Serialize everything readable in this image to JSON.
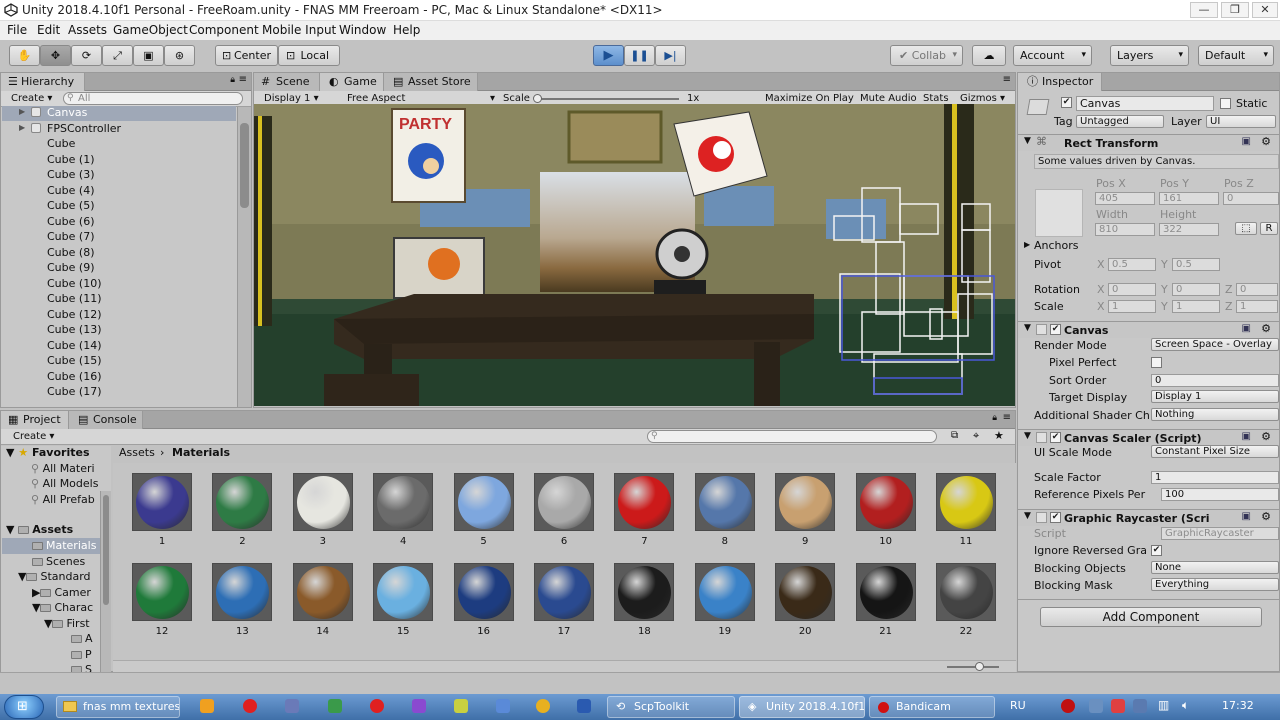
{
  "window": {
    "title": "Unity 2018.4.10f1 Personal - FreeRoam.unity - FNAS MM Freeroam - PC, Mac & Linux Standalone* <DX11>",
    "controls": [
      "—",
      "❐",
      "✕"
    ]
  },
  "menu": [
    "File",
    "Edit",
    "Assets",
    "GameObject",
    "Component",
    "Mobile Input",
    "Window",
    "Help"
  ],
  "toolbar": {
    "pivot": "Center",
    "space": "Local",
    "collab": "Collab",
    "account": "Account",
    "layers": "Layers",
    "layout": "Default"
  },
  "hierarchy": {
    "tab": "Hierarchy",
    "create": "Create",
    "search_placeholder": "All",
    "items": [
      "Canvas",
      "FPSController",
      "Cube",
      "Cube (1)",
      "Cube (3)",
      "Cube (4)",
      "Cube (5)",
      "Cube (6)",
      "Cube (7)",
      "Cube (8)",
      "Cube (9)",
      "Cube (10)",
      "Cube (11)",
      "Cube (12)",
      "Cube (13)",
      "Cube (14)",
      "Cube (15)",
      "Cube (16)",
      "Cube (17)"
    ]
  },
  "scene_tabs": [
    "Scene",
    "Game",
    "Asset Store"
  ],
  "game_bar": {
    "display": "Display 1",
    "aspect": "Free Aspect",
    "scale_label": "Scale",
    "scale_value": "1x",
    "maximize": "Maximize On Play",
    "mute": "Mute Audio",
    "stats": "Stats",
    "gizmos": "Gizmos"
  },
  "game_scene": {
    "poster_text": "PARTY"
  },
  "project": {
    "tabs": [
      "Project",
      "Console"
    ],
    "create": "Create",
    "favorites_label": "Favorites",
    "favorites": [
      "All Materi",
      "All Models",
      "All Prefab"
    ],
    "assets_label": "Assets",
    "tree": [
      "Materials",
      "Scenes",
      "Standard",
      "Camer",
      "Charac",
      "First",
      "A",
      "P",
      "S"
    ],
    "breadcrumb": [
      "Assets",
      "Materials"
    ],
    "materials": [
      {
        "label": "1",
        "color": "#3b3a8f"
      },
      {
        "label": "2",
        "color": "#2e7b45"
      },
      {
        "label": "3",
        "color": "#e6e6e0"
      },
      {
        "label": "4",
        "color": "#6b6b6b"
      },
      {
        "label": "5",
        "color": "#7ea7de"
      },
      {
        "label": "6",
        "color": "#a9a9a9"
      },
      {
        "label": "7",
        "color": "#cc1a1a"
      },
      {
        "label": "8",
        "color": "#5577aa"
      },
      {
        "label": "9",
        "color": "#c8a070"
      },
      {
        "label": "10",
        "color": "#b21f1f"
      },
      {
        "label": "11",
        "color": "#d8c814"
      },
      {
        "label": "12",
        "color": "#1f7a3a"
      },
      {
        "label": "13",
        "color": "#2d6eb5"
      },
      {
        "label": "14",
        "color": "#8a5a2a"
      },
      {
        "label": "15",
        "color": "#6ab0e0"
      },
      {
        "label": "16",
        "color": "#1d3c80"
      },
      {
        "label": "17",
        "color": "#2a4a90"
      },
      {
        "label": "18",
        "color": "#1c1c1c"
      },
      {
        "label": "19",
        "color": "#3a82c8"
      },
      {
        "label": "20",
        "color": "#3a2a18"
      },
      {
        "label": "21",
        "color": "#151515"
      },
      {
        "label": "22",
        "color": "#444444"
      }
    ]
  },
  "inspector": {
    "tab": "Inspector",
    "object_name": "Canvas",
    "static": "Static",
    "tag_label": "Tag",
    "tag_value": "Untagged",
    "layer_label": "Layer",
    "layer_value": "UI",
    "rect_transform": {
      "title": "Rect Transform",
      "note": "Some values driven by Canvas.",
      "pos_x_label": "Pos X",
      "pos_y_label": "Pos Y",
      "pos_z_label": "Pos Z",
      "pos_x": "405",
      "pos_y": "161",
      "pos_z": "0",
      "width_label": "Width",
      "height_label": "Height",
      "width": "810",
      "height": "322",
      "r_button": "R",
      "anchors": "Anchors",
      "pivot_label": "Pivot",
      "pivot_x": "0.5",
      "pivot_y": "0.5",
      "rotation_label": "Rotation",
      "rot_x": "0",
      "rot_y": "0",
      "rot_z": "0",
      "scale_label": "Scale",
      "scale_x": "1",
      "scale_y": "1",
      "scale_z": "1",
      "axis_x": "X",
      "axis_y": "Y",
      "axis_z": "Z"
    },
    "canvas": {
      "title": "Canvas",
      "render_mode_label": "Render Mode",
      "render_mode": "Screen Space - Overlay",
      "pixel_perfect_label": "Pixel Perfect",
      "sort_order_label": "Sort Order",
      "sort_order": "0",
      "target_display_label": "Target Display",
      "target_display": "Display 1",
      "shader_label": "Additional Shader Ch",
      "shader_value": "Nothing"
    },
    "scaler": {
      "title": "Canvas Scaler (Script)",
      "ui_scale_label": "UI Scale Mode",
      "ui_scale": "Constant Pixel Size",
      "scale_factor_label": "Scale Factor",
      "scale_factor": "1",
      "ref_ppu_label": "Reference Pixels Per",
      "ref_ppu": "100"
    },
    "raycaster": {
      "title": "Graphic Raycaster (Scri",
      "script_label": "Script",
      "script_value": "GraphicRaycaster",
      "ignore_label": "Ignore Reversed Gra",
      "blocking_objects_label": "Blocking Objects",
      "blocking_objects": "None",
      "blocking_mask_label": "Blocking Mask",
      "blocking_mask": "Everything"
    },
    "add_component": "Add Component"
  },
  "taskbar": {
    "tasks": [
      "fnas mm textures",
      "ScpToolkit",
      "Unity 2018.4.10f1...",
      "Bandicam"
    ],
    "lang": "RU",
    "time": "17:32"
  }
}
